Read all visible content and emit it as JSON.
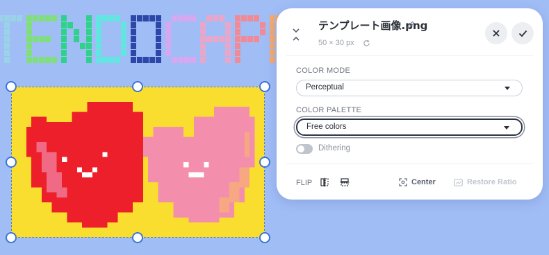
{
  "banner_text": "TENDOCAPRIS",
  "banner_colors": [
    "#9ad3e8",
    "#7fe07a",
    "#2fd28b",
    "#5fe8e0",
    "#2c47a8",
    "#d9a6f0",
    "#eaa6c8",
    "#f08a96",
    "#f6a96c",
    "#c9cdd2",
    "#6fe0d9"
  ],
  "image_colors": {
    "background": "#f9dd2f",
    "red_heart": "#ec1f2a",
    "red_heart_light": "#f06a85",
    "pink_heart": "#f38fac",
    "pink_heart_shade": "#f7a882",
    "face": "#ffffff"
  },
  "panel": {
    "filename": "テンプレート画像.png",
    "dimensions": "50 × 30 px",
    "color_mode_label": "COLOR MODE",
    "color_mode_value": "Perceptual",
    "color_palette_label": "COLOR PALETTE",
    "color_palette_value": "Free colors",
    "dithering_label": "Dithering",
    "dithering_on": false,
    "flip_label": "FLIP",
    "center_label": "Center",
    "restore_ratio_label": "Restore Ratio"
  },
  "icons": {
    "collapse": "collapse-icon",
    "edit": "pencil-icon",
    "reset_size": "refresh-icon",
    "cancel": "close-icon",
    "confirm": "check-icon",
    "flip_horizontal": "flip-horizontal-icon",
    "flip_vertical": "flip-vertical-icon",
    "center": "center-focus-icon",
    "restore_ratio": "aspect-ratio-icon"
  }
}
